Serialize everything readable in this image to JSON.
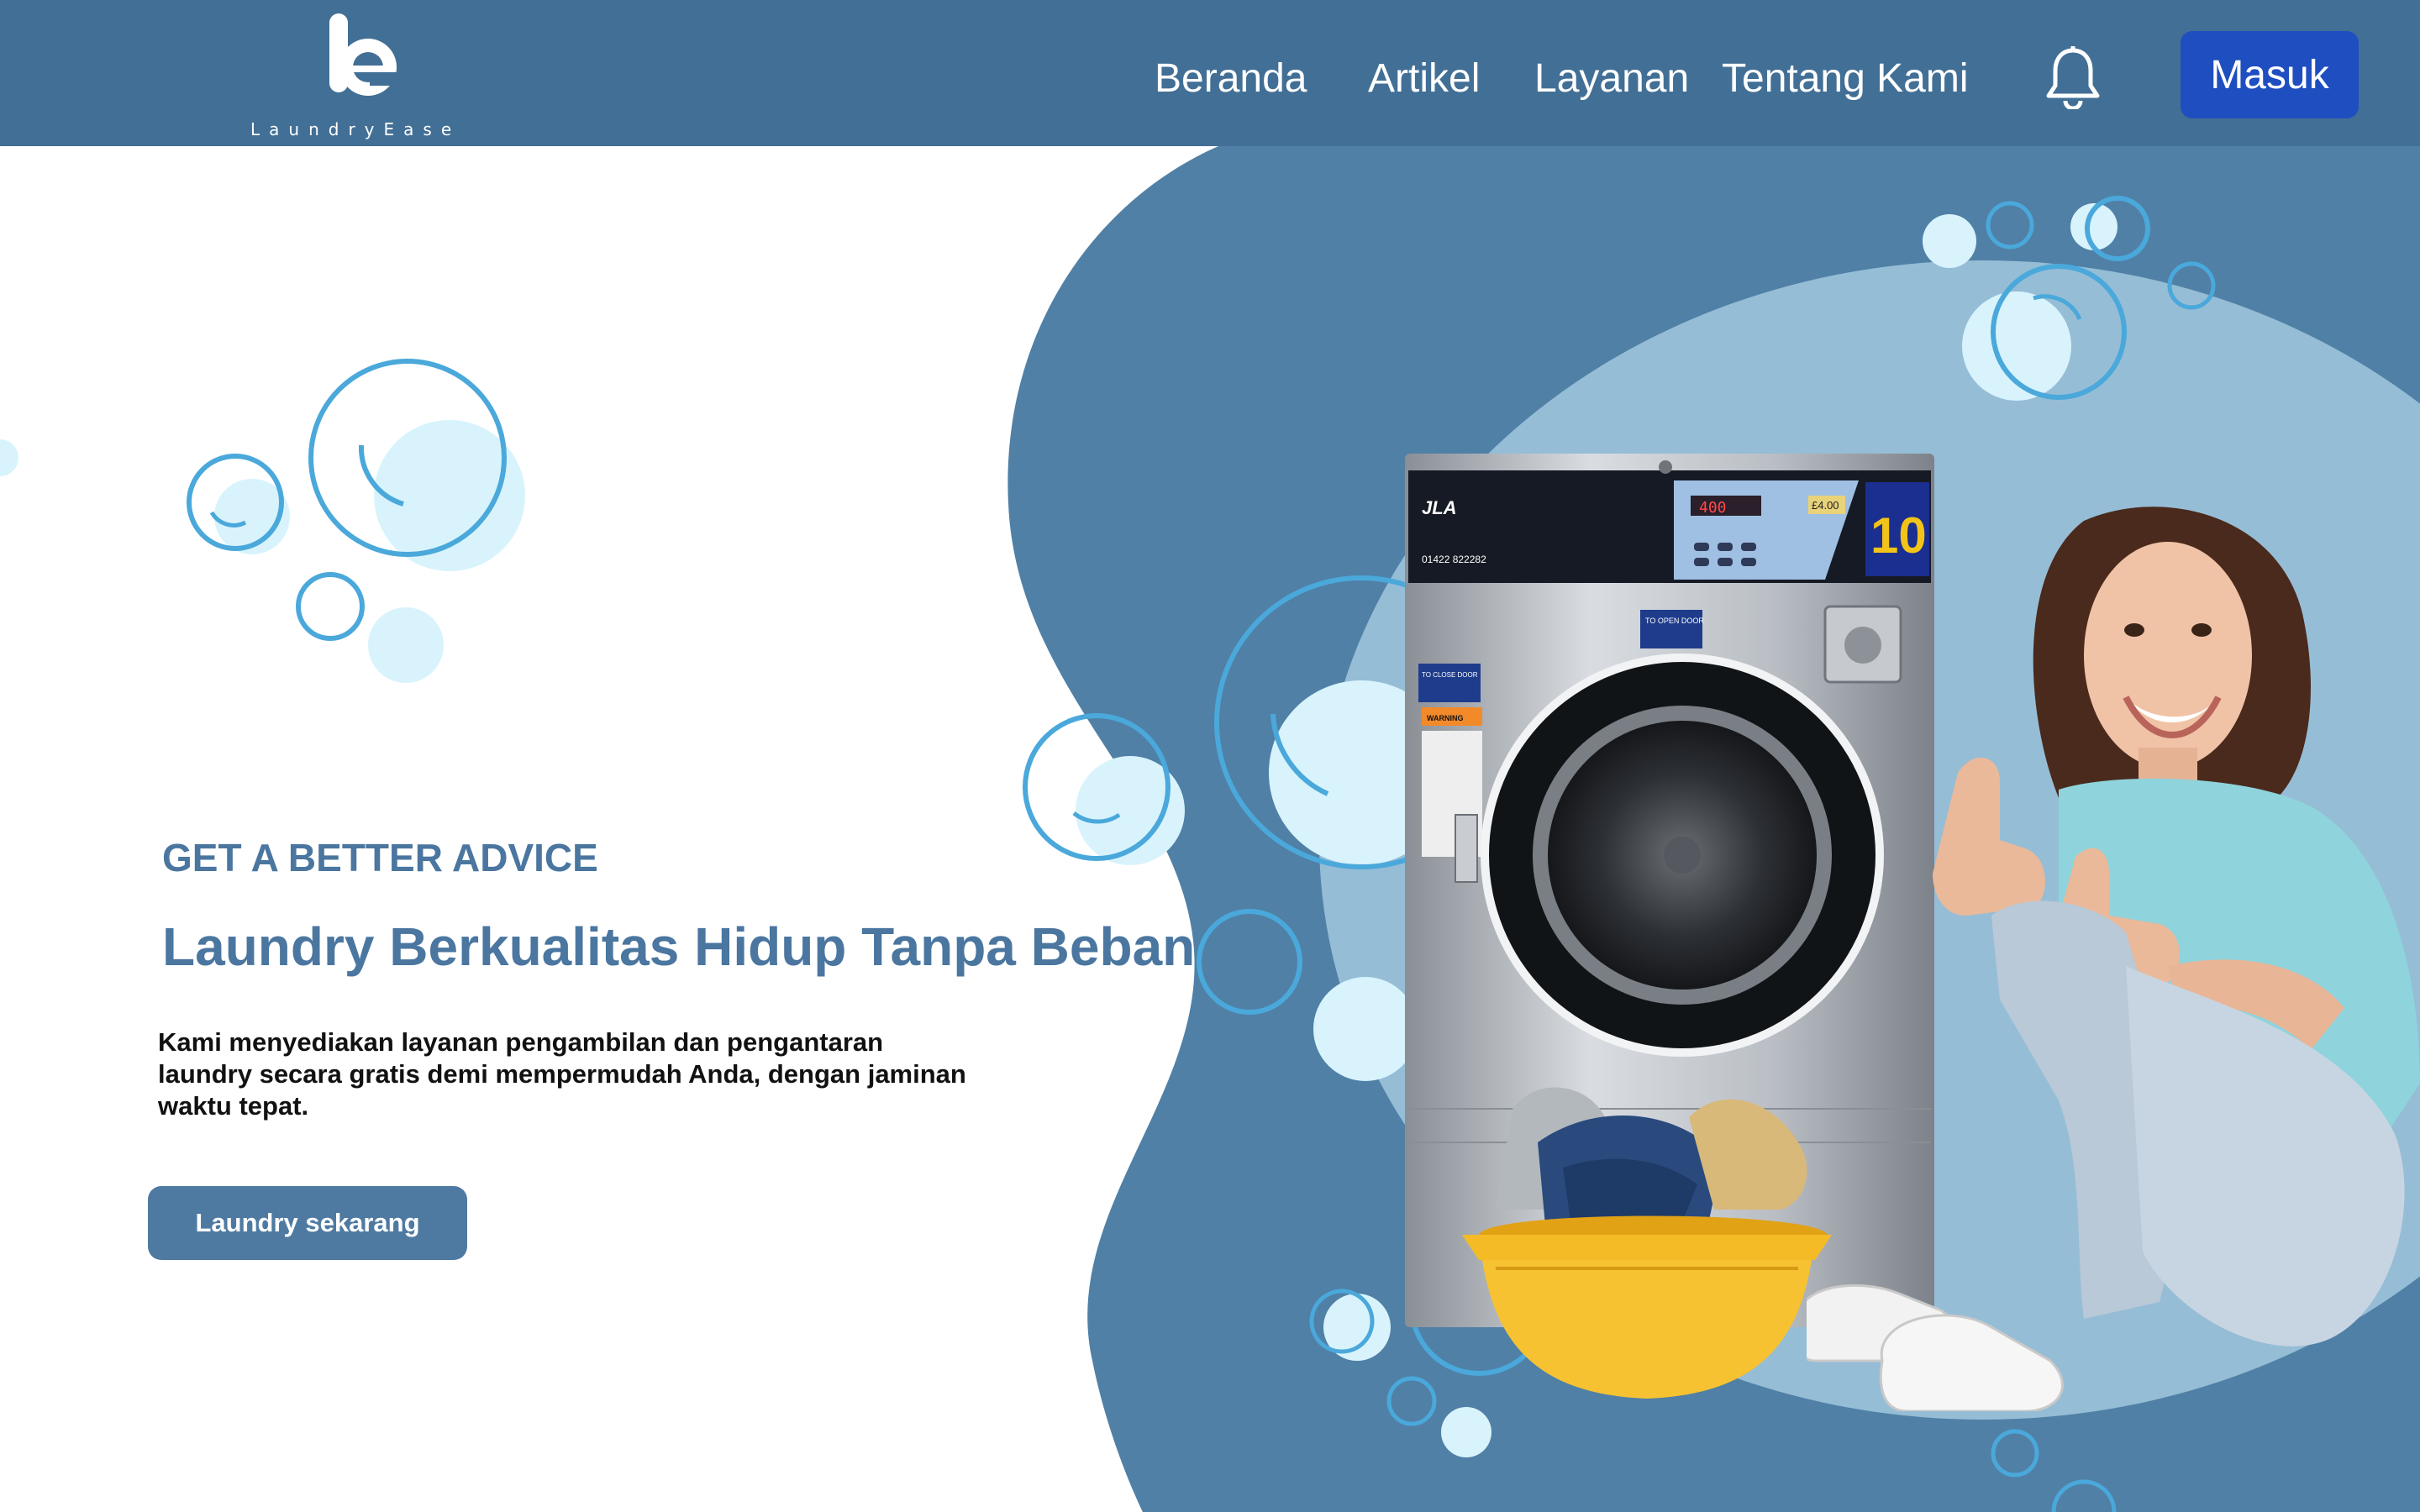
{
  "brand": {
    "logo_letter": "e",
    "name": "LaundryEase"
  },
  "nav": {
    "items": [
      {
        "label": "Beranda"
      },
      {
        "label": "Artikel"
      },
      {
        "label": "Layanan"
      },
      {
        "label": "Tentang Kami"
      }
    ],
    "notification_icon": "bell-icon",
    "login_label": "Masuk"
  },
  "hero": {
    "eyebrow": "GET A BETTER ADVICE",
    "headline": "Laundry Berkualitas Hidup Tanpa Beban",
    "description": "Kami menyediakan layanan pengambilan dan pengantaran laundry secara gratis demi mempermudah Anda, dengan jaminan waktu tepat.",
    "cta_label": "Laundry sekarang"
  },
  "machine": {
    "brand": "JLA",
    "phone": "01422 822282",
    "display": "400",
    "price": "£4.00",
    "cycle_number": "10",
    "open_door_label": "TO OPEN DOOR",
    "close_door_label": "TO CLOSE DOOR",
    "warning_label": "WARNING"
  },
  "colors": {
    "header": "#426f96",
    "blob_dark": "#5080a6",
    "blob_light": "#96bdd6",
    "bubble_ring": "#4aa8db",
    "bubble_fill": "#d8f3fc",
    "accent_text": "#4a76a0",
    "login_button": "#1e4ec0",
    "cta_button": "#4e7aa2"
  }
}
